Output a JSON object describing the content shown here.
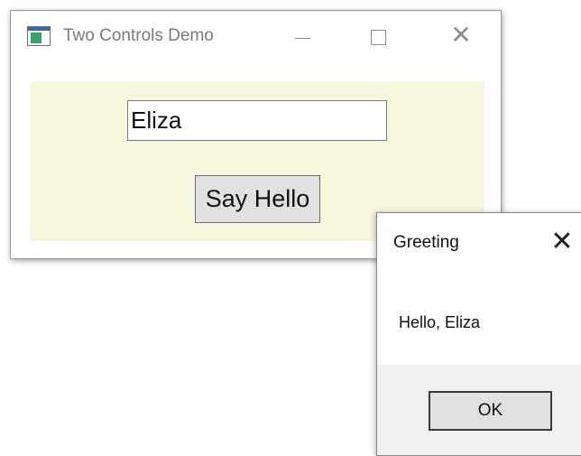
{
  "main_window": {
    "title": "Two Controls Demo",
    "icon": "app-window-icon",
    "controls": {
      "minimize_icon": "minimize-icon",
      "maximize_icon": "maximize-icon",
      "close_icon": "close-icon",
      "close_glyph": "✕"
    },
    "client_background": "#f7f7de",
    "name_input": {
      "value": "Eliza"
    },
    "say_hello_button": {
      "label": "Say Hello"
    }
  },
  "dialog": {
    "title": "Greeting",
    "close_glyph": "✕",
    "message": "Hello, Eliza",
    "ok_label": "OK"
  }
}
